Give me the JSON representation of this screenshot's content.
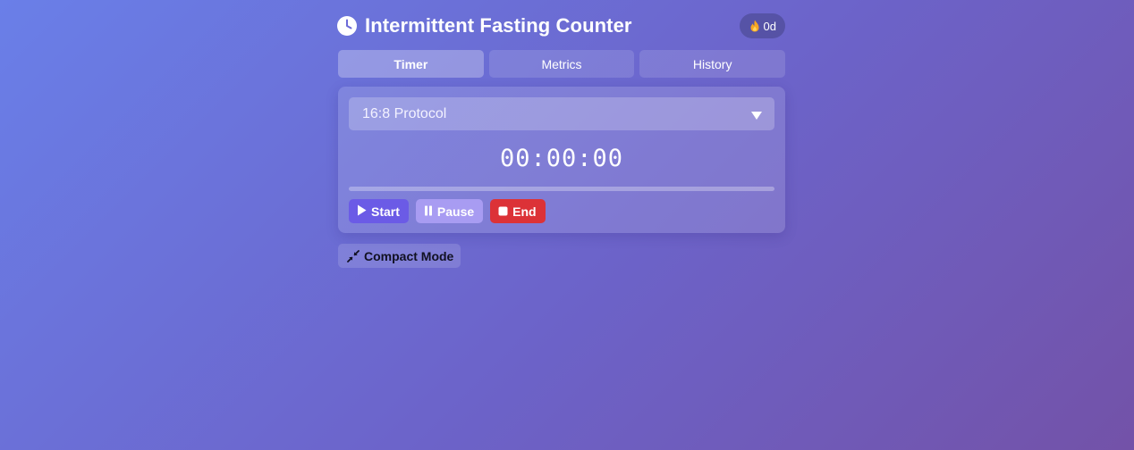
{
  "header": {
    "title": "Intermittent Fasting Counter",
    "clock_icon": "clock-icon",
    "streak": {
      "icon": "flame-icon",
      "label": "0d"
    }
  },
  "tabs": [
    {
      "label": "Timer",
      "active": true
    },
    {
      "label": "Metrics",
      "active": false
    },
    {
      "label": "History",
      "active": false
    }
  ],
  "timer_card": {
    "protocol": {
      "selected": "16:8 Protocol",
      "icon": "chevron-down-icon"
    },
    "time_display": "00:00:00",
    "progress_fraction": 0,
    "controls": {
      "start_label": "Start",
      "pause_label": "Pause",
      "end_label": "End"
    }
  },
  "compact_mode": {
    "label": "Compact Mode",
    "icon": "compress-icon"
  },
  "colors": {
    "start": "#6b5be6",
    "pause": "#a89cf2",
    "end": "#dc3237"
  }
}
